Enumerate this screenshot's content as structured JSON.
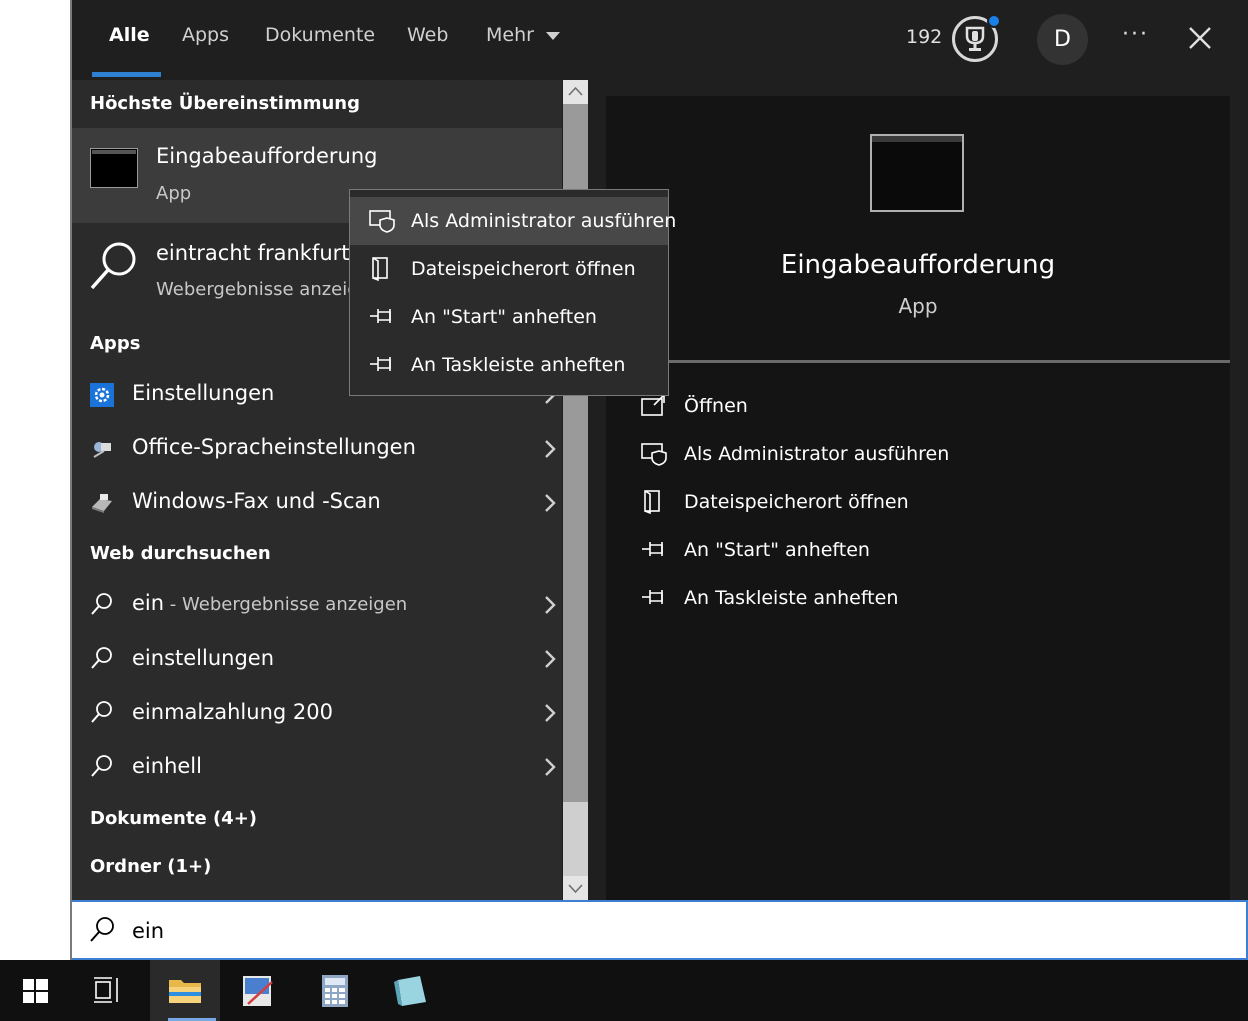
{
  "tabs": [
    {
      "label": "Alle"
    },
    {
      "label": "Apps"
    },
    {
      "label": "Dokumente"
    },
    {
      "label": "Web"
    },
    {
      "label": "Mehr"
    }
  ],
  "header": {
    "rewards_count": "192",
    "avatar_letter": "D",
    "more": "···"
  },
  "best_match": {
    "heading": "Höchste Übereinstimmung",
    "title": "Eingabeaufforderung",
    "subtitle": "App"
  },
  "web_top": {
    "title": "eintracht frankfurt",
    "subtitle": "Webergebnisse anzeig"
  },
  "apps": {
    "heading": "Apps",
    "items": [
      {
        "label": "Einstellungen"
      },
      {
        "label": "Office-Spracheinstellungen"
      },
      {
        "label": "Windows-Fax und -Scan"
      }
    ]
  },
  "web": {
    "heading": "Web durchsuchen",
    "items": [
      {
        "label": "ein",
        "suffix": " - Webergebnisse anzeigen"
      },
      {
        "label": "einstellungen"
      },
      {
        "label": "einmalzahlung 200"
      },
      {
        "label": "einhell"
      }
    ]
  },
  "sections": {
    "documents": "Dokumente (4+)",
    "folders": "Ordner (1+)"
  },
  "context_menu": {
    "items": [
      {
        "label": "Als Administrator ausführen"
      },
      {
        "label": "Dateispeicherort öffnen"
      },
      {
        "label": "An \"Start\" anheften"
      },
      {
        "label": "An Taskleiste anheften"
      }
    ]
  },
  "preview": {
    "title": "Eingabeaufforderung",
    "subtitle": "App",
    "actions": [
      {
        "label": "Öffnen"
      },
      {
        "label": "Als Administrator ausführen"
      },
      {
        "label": "Dateispeicherort öffnen"
      },
      {
        "label": "An \"Start\" anheften"
      },
      {
        "label": "An Taskleiste anheften"
      }
    ]
  },
  "search": {
    "value": "ein"
  },
  "colors": {
    "accent": "#2f7fd3",
    "panel": "#1f1f1f",
    "list": "#2b2b2b"
  },
  "icons": {
    "windows": "windows-logo-icon",
    "taskview": "task-view-icon",
    "explorer": "file-explorer-icon",
    "paint": "paint-app-icon",
    "calculator": "calculator-icon",
    "notes": "notes-app-icon"
  }
}
